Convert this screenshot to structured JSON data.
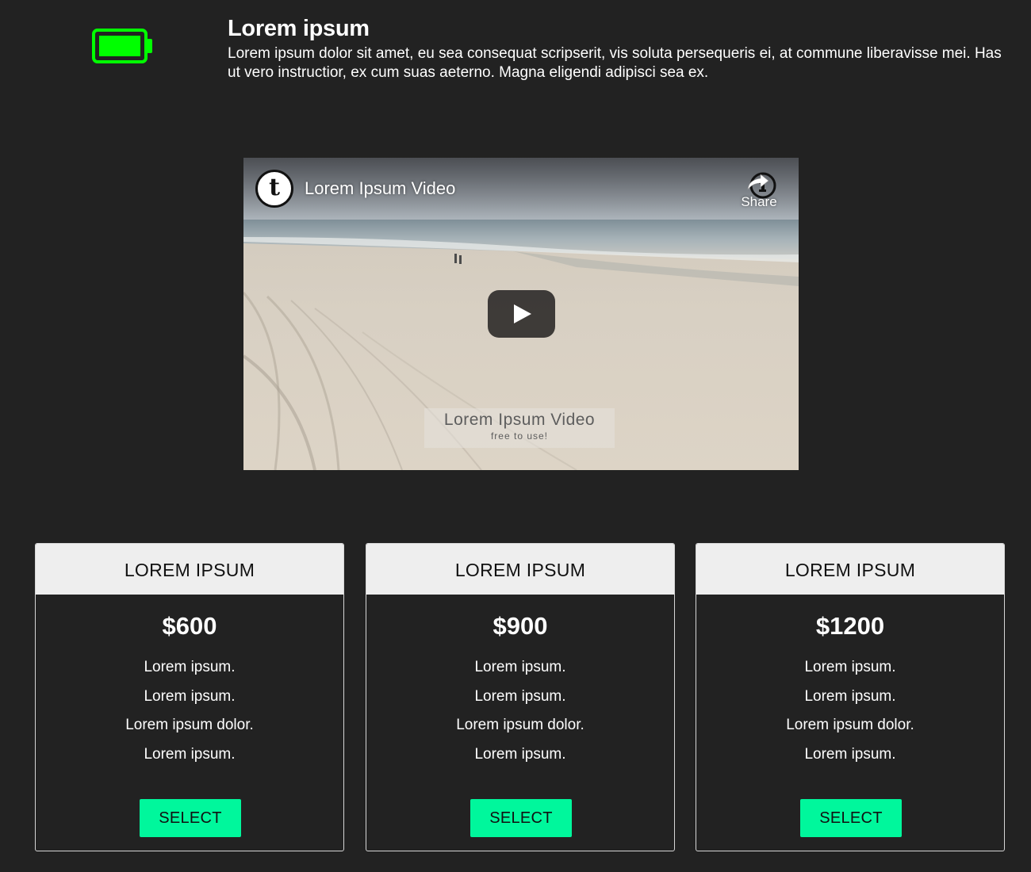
{
  "feature": {
    "icon": "battery-full-icon",
    "icon_color": "#00ff00",
    "title": "Lorem ipsum",
    "description": "Lorem ipsum dolor sit amet, eu sea consequat scripserit, vis soluta persequeris ei, at commune liberavisse mei. Has ut vero instructior, ex cum suas aeterno. Magna eligendi adipisci sea ex."
  },
  "video": {
    "title": "Lorem Ipsum Video",
    "channel_logo_letter": "t",
    "share_label": "Share",
    "watermark_title": "Lorem Ipsum Video",
    "watermark_subtitle": "free to use!"
  },
  "pricing": {
    "accent_color": "#00f79c",
    "cards": [
      {
        "title": "LOREM IPSUM",
        "price": "$600",
        "features": [
          "Lorem ipsum.",
          "Lorem ipsum.",
          "Lorem ipsum dolor.",
          "Lorem ipsum."
        ],
        "button_label": "SELECT"
      },
      {
        "title": "LOREM IPSUM",
        "price": "$900",
        "features": [
          "Lorem ipsum.",
          "Lorem ipsum.",
          "Lorem ipsum dolor.",
          "Lorem ipsum."
        ],
        "button_label": "SELECT"
      },
      {
        "title": "LOREM IPSUM",
        "price": "$1200",
        "features": [
          "Lorem ipsum.",
          "Lorem ipsum.",
          "Lorem ipsum dolor.",
          "Lorem ipsum."
        ],
        "button_label": "SELECT"
      }
    ]
  }
}
